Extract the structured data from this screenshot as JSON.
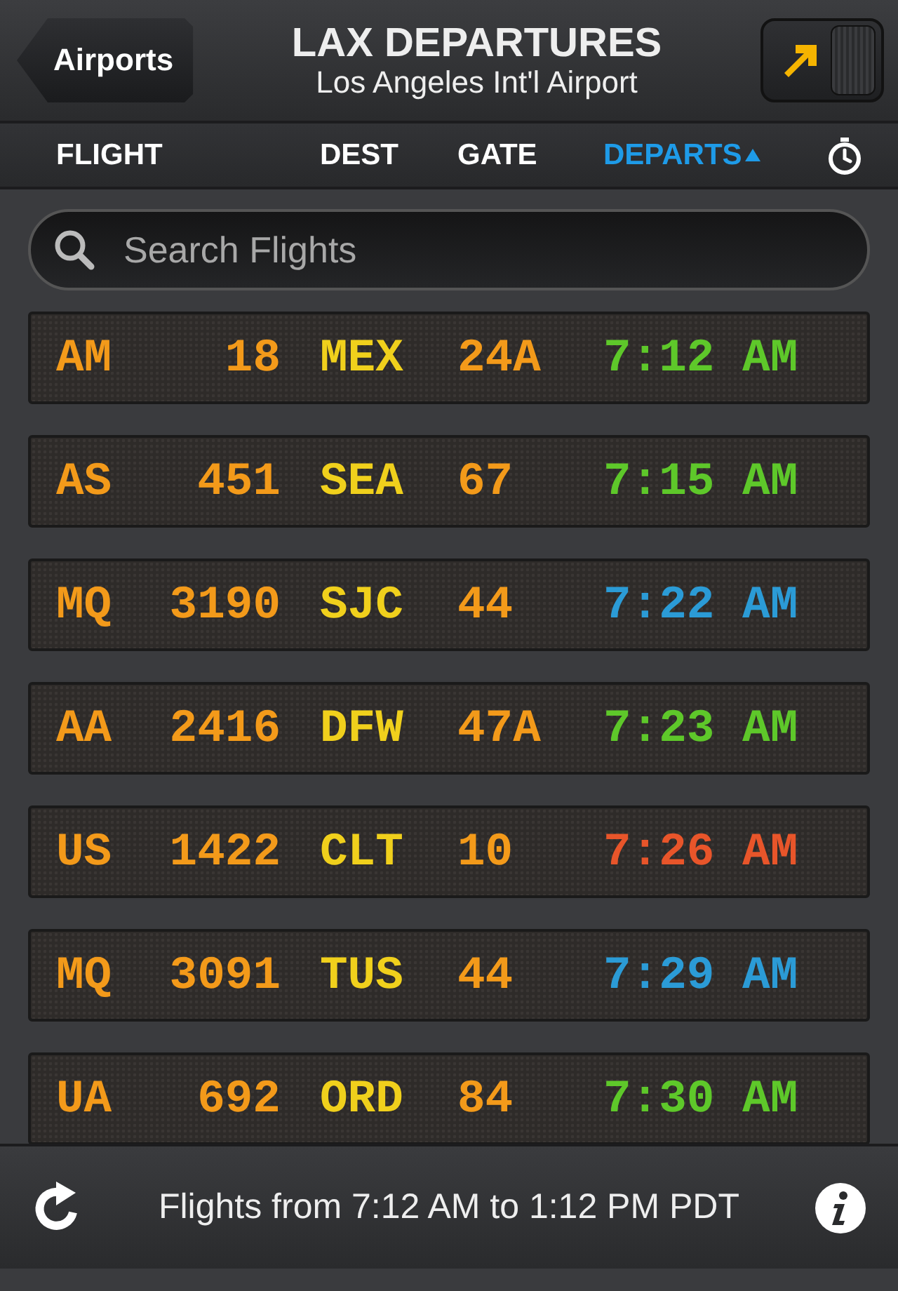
{
  "header": {
    "back_button": "Airports",
    "title": "LAX DEPARTURES",
    "subtitle": "Los Angeles Int'l Airport",
    "direction_toggle": {
      "on": true
    }
  },
  "columns": [
    {
      "label": "FLIGHT",
      "selected": false
    },
    {
      "label": "DEST",
      "selected": false
    },
    {
      "label": "GATE",
      "selected": false
    },
    {
      "label": "DEPARTS",
      "selected": true
    }
  ],
  "search": {
    "placeholder": "Search Flights"
  },
  "flights": [
    {
      "airline": "AM",
      "number": "18",
      "dest": "MEX",
      "gate": "24A",
      "departs": "7:12 AM",
      "color": "#5ec82a"
    },
    {
      "airline": "AS",
      "number": "451",
      "dest": "SEA",
      "gate": "67",
      "departs": "7:15 AM",
      "color": "#5ec82a"
    },
    {
      "airline": "MQ",
      "number": "3190",
      "dest": "SJC",
      "gate": "44",
      "departs": "7:22 AM",
      "color": "#2b9bd6"
    },
    {
      "airline": "AA",
      "number": "2416",
      "dest": "DFW",
      "gate": "47A",
      "departs": "7:23 AM",
      "color": "#5ec82a"
    },
    {
      "airline": "US",
      "number": "1422",
      "dest": "CLT",
      "gate": "10",
      "departs": "7:26 AM",
      "color": "#e8552a"
    },
    {
      "airline": "MQ",
      "number": "3091",
      "dest": "TUS",
      "gate": "44",
      "departs": "7:29 AM",
      "color": "#2b9bd6"
    },
    {
      "airline": "UA",
      "number": "692",
      "dest": "ORD",
      "gate": "84",
      "departs": "7:30 AM",
      "color": "#5ec82a"
    }
  ],
  "footer": {
    "status": "Flights from 7:12 AM to 1:12 PM PDT"
  }
}
